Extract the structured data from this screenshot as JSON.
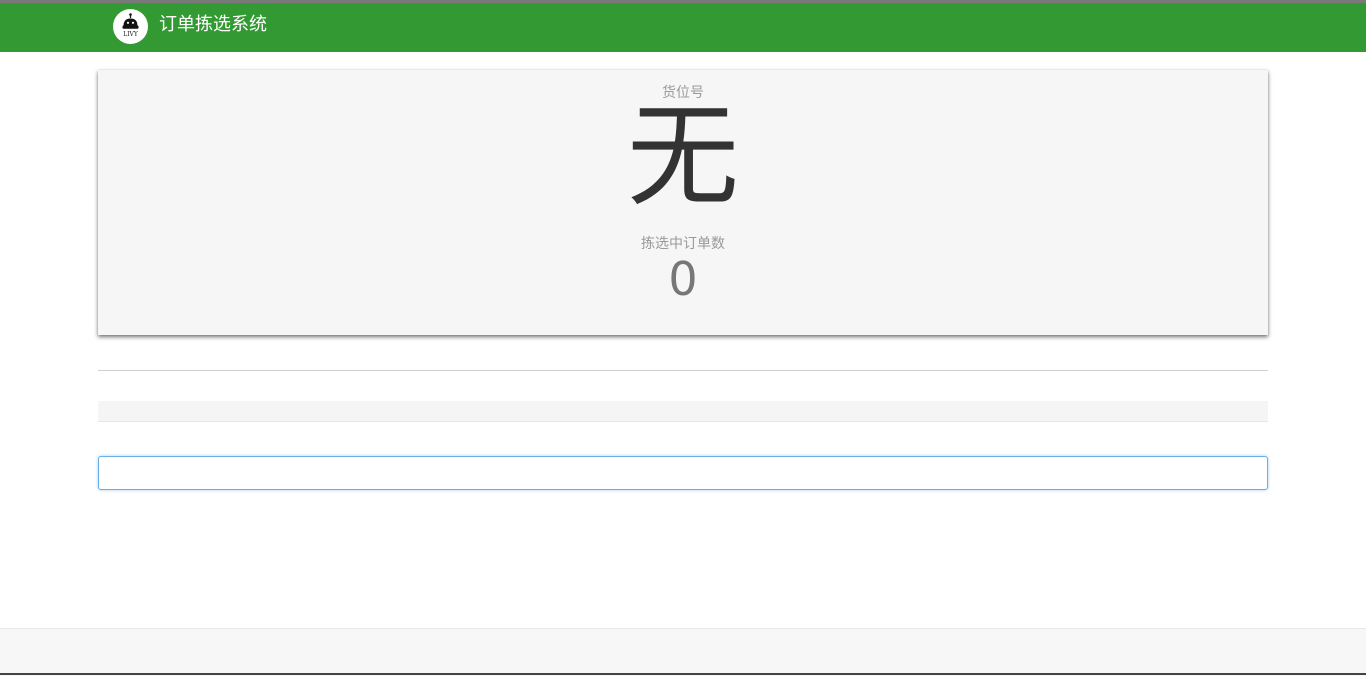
{
  "header": {
    "logo_text": "LIVY",
    "app_title": "订单拣选系统",
    "background_color": "#339933",
    "logo_icon": "robot-icon"
  },
  "main": {
    "location_label": "货位号",
    "location_value": "无",
    "picking_count_label": "拣选中订单数",
    "picking_count_value": "0"
  },
  "scan": {
    "value": "",
    "placeholder": ""
  },
  "colors": {
    "focus_border": "#66afe9",
    "panel_background": "#f6f6f6"
  }
}
